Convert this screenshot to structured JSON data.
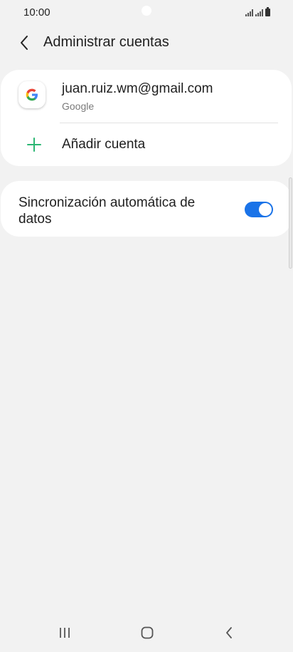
{
  "status_bar": {
    "time": "10:00"
  },
  "header": {
    "title": "Administrar cuentas"
  },
  "accounts": [
    {
      "email": "juan.ruiz.wm@gmail.com",
      "type": "Google",
      "icon": "google-icon"
    }
  ],
  "add_account": {
    "label": "Añadir cuenta",
    "icon": "plus-icon"
  },
  "sync": {
    "label": "Sincronización automática de datos",
    "enabled": true
  },
  "nav": {
    "recents_icon": "recents-icon",
    "home_icon": "home-icon",
    "back_icon": "back-icon"
  },
  "colors": {
    "background": "#f2f2f2",
    "card": "#ffffff",
    "accent": "#1a73e8",
    "plus": "#2bb673"
  }
}
